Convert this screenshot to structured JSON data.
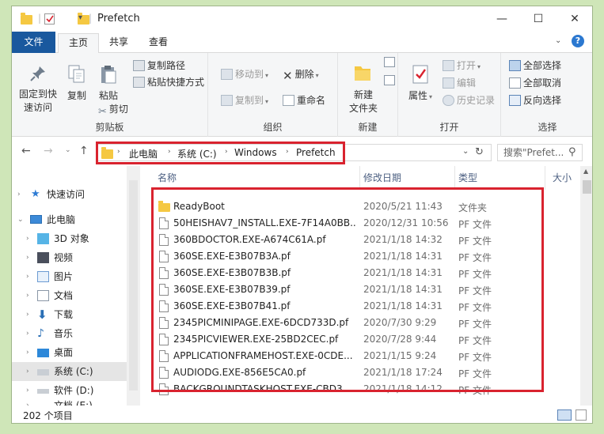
{
  "title": "Prefetch",
  "window_controls": {
    "minimize": "—",
    "maximize": "☐",
    "close": "✕"
  },
  "tabs": {
    "file": "文件",
    "home": "主页",
    "share": "共享",
    "view": "查看"
  },
  "ribbon": {
    "clipboard": {
      "label": "剪贴板",
      "pin": "固定到快\n速访问",
      "copy": "复制",
      "paste": "粘贴",
      "copy_path": "复制路径",
      "paste_shortcut": "粘贴快捷方式",
      "cut": "剪切"
    },
    "organize": {
      "label": "组织",
      "move_to": "移动到",
      "copy_to": "复制到",
      "delete": "删除",
      "rename": "重命名"
    },
    "new": {
      "label": "新建",
      "new_folder": "新建\n文件夹"
    },
    "open": {
      "label": "打开",
      "properties": "属性",
      "open": "打开",
      "edit": "编辑",
      "history": "历史记录"
    },
    "select": {
      "label": "选择",
      "select_all": "全部选择",
      "select_none": "全部取消",
      "invert": "反向选择"
    }
  },
  "address": {
    "segments": [
      "此电脑",
      "系统 (C:)",
      "Windows",
      "Prefetch"
    ],
    "search_placeholder": "搜索\"Prefet..."
  },
  "nav": {
    "quick_access": "快速访问",
    "this_pc": "此电脑",
    "objects3d": "3D 对象",
    "videos": "视频",
    "pictures": "图片",
    "documents": "文档",
    "downloads": "下载",
    "music": "音乐",
    "desktop": "桌面",
    "drive_c": "系统 (C:)",
    "drive_d": "软件 (D:)",
    "drive_e": "文档 (E:)"
  },
  "columns": {
    "name": "名称",
    "date": "修改日期",
    "type": "类型",
    "size": "大小"
  },
  "files": [
    {
      "name": "ReadyBoot",
      "date": "2020/5/21 11:43",
      "type": "文件夹",
      "folder": true
    },
    {
      "name": "50HEISHAV7_INSTALL.EXE-7F14A0BB....",
      "date": "2020/12/31 10:56",
      "type": "PF 文件"
    },
    {
      "name": "360BDOCTOR.EXE-A674C61A.pf",
      "date": "2021/1/18 14:32",
      "type": "PF 文件"
    },
    {
      "name": "360SE.EXE-E3B07B3A.pf",
      "date": "2021/1/18 14:31",
      "type": "PF 文件"
    },
    {
      "name": "360SE.EXE-E3B07B3B.pf",
      "date": "2021/1/18 14:31",
      "type": "PF 文件"
    },
    {
      "name": "360SE.EXE-E3B07B39.pf",
      "date": "2021/1/18 14:31",
      "type": "PF 文件"
    },
    {
      "name": "360SE.EXE-E3B07B41.pf",
      "date": "2021/1/18 14:31",
      "type": "PF 文件"
    },
    {
      "name": "2345PICMINIPAGE.EXE-6DCD733D.pf",
      "date": "2020/7/30 9:29",
      "type": "PF 文件"
    },
    {
      "name": "2345PICVIEWER.EXE-25BD2CEC.pf",
      "date": "2020/7/28 9:44",
      "type": "PF 文件"
    },
    {
      "name": "APPLICATIONFRAMEHOST.EXE-0CDE...",
      "date": "2021/1/15 9:24",
      "type": "PF 文件"
    },
    {
      "name": "AUDIODG.EXE-856E5CA0.pf",
      "date": "2021/1/18 17:24",
      "type": "PF 文件"
    },
    {
      "name": "BACKGROUNDTASKHOST.EXE-CBD3....",
      "date": "2021/1/18 14:12",
      "type": "PF 文件"
    }
  ],
  "status": {
    "count": "202 个项目"
  },
  "colors": {
    "file_tab": "#19589e",
    "highlight": "#d9232f",
    "folder": "#f5c842"
  }
}
